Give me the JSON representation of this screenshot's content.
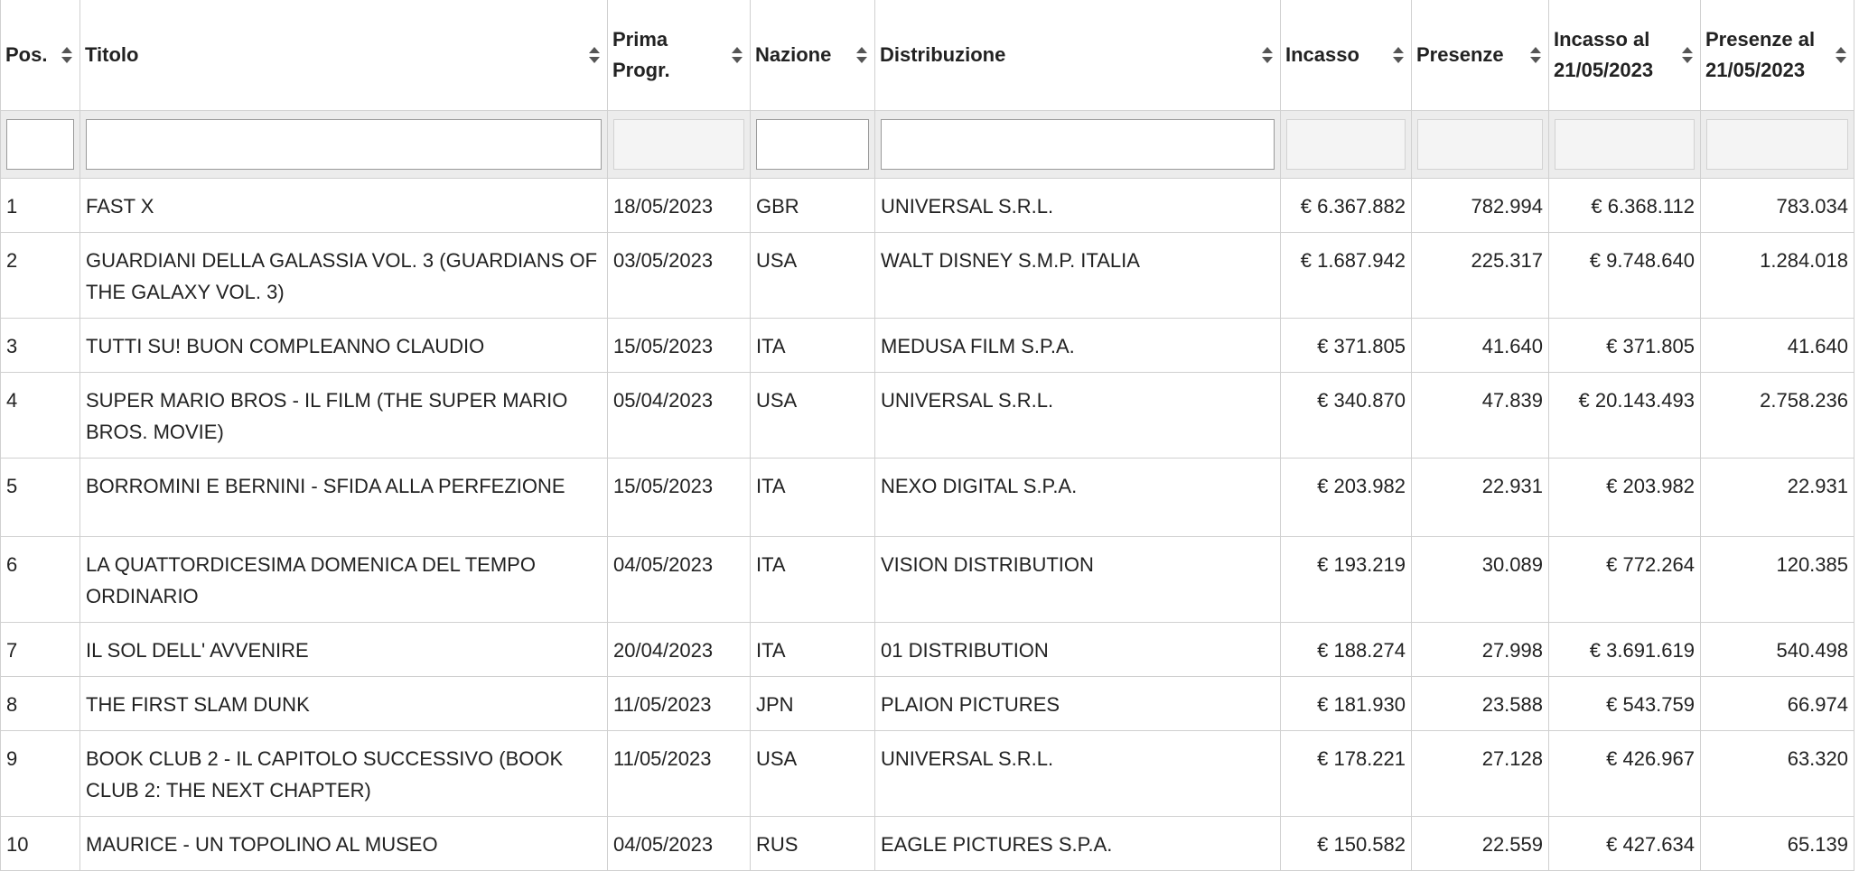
{
  "columns": [
    {
      "key": "pos",
      "label": "Pos.",
      "filter": "text"
    },
    {
      "key": "titolo",
      "label": "Titolo",
      "filter": "text"
    },
    {
      "key": "prima_progr",
      "label": "Prima Progr.",
      "filter": "disabled"
    },
    {
      "key": "nazione",
      "label": "Nazione",
      "filter": "text"
    },
    {
      "key": "distribuzione",
      "label": "Distribuzione",
      "filter": "text"
    },
    {
      "key": "incasso",
      "label": "Incasso",
      "filter": "disabled"
    },
    {
      "key": "presenze",
      "label": "Presenze",
      "filter": "disabled"
    },
    {
      "key": "incasso_al",
      "label": "Incasso al 21/05/2023",
      "filter": "disabled"
    },
    {
      "key": "presenze_al",
      "label": "Presenze al 21/05/2023",
      "filter": "disabled"
    }
  ],
  "filters": {
    "pos": "",
    "titolo": "",
    "nazione": "",
    "distribuzione": ""
  },
  "rows": [
    {
      "pos": "1",
      "titolo": "FAST X",
      "prima_progr": "18/05/2023",
      "nazione": "GBR",
      "distribuzione": "UNIVERSAL S.R.L.",
      "incasso": "€ 6.367.882",
      "presenze": "782.994",
      "incasso_al": "€ 6.368.112",
      "presenze_al": "783.034"
    },
    {
      "pos": "2",
      "titolo": "GUARDIANI DELLA GALASSIA VOL. 3 (GUARDIANS OF THE GALAXY VOL. 3)",
      "prima_progr": "03/05/2023",
      "nazione": "USA",
      "distribuzione": "WALT DISNEY S.M.P. ITALIA",
      "incasso": "€ 1.687.942",
      "presenze": "225.317",
      "incasso_al": "€ 9.748.640",
      "presenze_al": "1.284.018"
    },
    {
      "pos": "3",
      "titolo": "TUTTI SU! BUON COMPLEANNO CLAUDIO",
      "prima_progr": "15/05/2023",
      "nazione": "ITA",
      "distribuzione": "MEDUSA FILM S.P.A.",
      "incasso": "€ 371.805",
      "presenze": "41.640",
      "incasso_al": "€ 371.805",
      "presenze_al": "41.640"
    },
    {
      "pos": "4",
      "titolo": "SUPER MARIO BROS - IL FILM (THE SUPER MARIO BROS. MOVIE)",
      "prima_progr": "05/04/2023",
      "nazione": "USA",
      "distribuzione": "UNIVERSAL S.R.L.",
      "incasso": "€ 340.870",
      "presenze": "47.839",
      "incasso_al": "€ 20.143.493",
      "presenze_al": "2.758.236"
    },
    {
      "pos": "5",
      "titolo": "BORROMINI E BERNINI - SFIDA ALLA PERFEZIONE",
      "prima_progr": "15/05/2023",
      "nazione": "ITA",
      "distribuzione": "NEXO DIGITAL S.P.A.",
      "incasso": "€ 203.982",
      "presenze": "22.931",
      "incasso_al": "€ 203.982",
      "presenze_al": "22.931"
    },
    {
      "pos": "6",
      "titolo": "LA QUATTORDICESIMA DOMENICA DEL TEMPO ORDINARIO",
      "prima_progr": "04/05/2023",
      "nazione": "ITA",
      "distribuzione": "VISION DISTRIBUTION",
      "incasso": "€ 193.219",
      "presenze": "30.089",
      "incasso_al": "€ 772.264",
      "presenze_al": "120.385"
    },
    {
      "pos": "7",
      "titolo": "IL SOL DELL' AVVENIRE",
      "prima_progr": "20/04/2023",
      "nazione": "ITA",
      "distribuzione": "01 DISTRIBUTION",
      "incasso": "€ 188.274",
      "presenze": "27.998",
      "incasso_al": "€ 3.691.619",
      "presenze_al": "540.498"
    },
    {
      "pos": "8",
      "titolo": "THE FIRST SLAM DUNK",
      "prima_progr": "11/05/2023",
      "nazione": "JPN",
      "distribuzione": "PLAION PICTURES",
      "incasso": "€ 181.930",
      "presenze": "23.588",
      "incasso_al": "€ 543.759",
      "presenze_al": "66.974"
    },
    {
      "pos": "9",
      "titolo": "BOOK CLUB 2 - IL CAPITOLO SUCCESSIVO (BOOK CLUB 2: THE NEXT CHAPTER)",
      "prima_progr": "11/05/2023",
      "nazione": "USA",
      "distribuzione": "UNIVERSAL S.R.L.",
      "incasso": "€ 178.221",
      "presenze": "27.128",
      "incasso_al": "€ 426.967",
      "presenze_al": "63.320"
    },
    {
      "pos": "10",
      "titolo": "MAURICE - UN TOPOLINO AL MUSEO",
      "prima_progr": "04/05/2023",
      "nazione": "RUS",
      "distribuzione": "EAGLE PICTURES S.P.A.",
      "incasso": "€ 150.582",
      "presenze": "22.559",
      "incasso_al": "€ 427.634",
      "presenze_al": "65.139"
    }
  ],
  "icons": {
    "sort": "sort-both-icon"
  }
}
